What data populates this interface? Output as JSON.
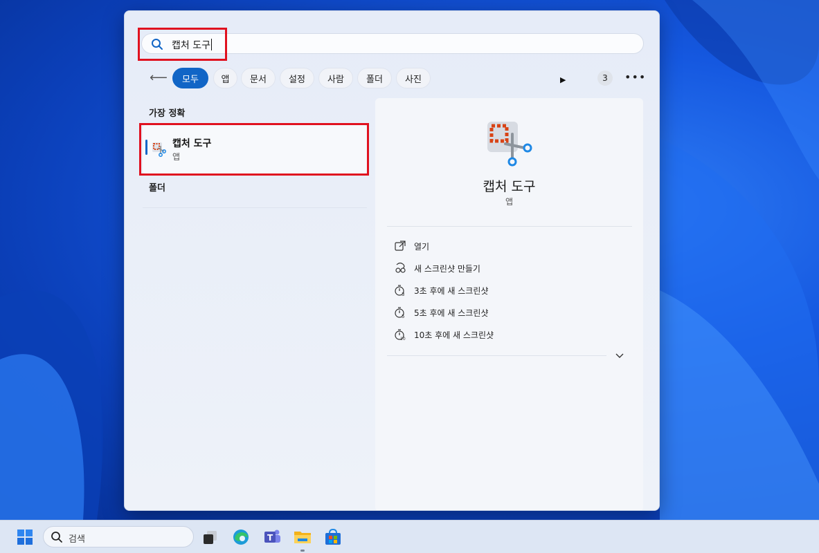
{
  "search": {
    "query": "캡처 도구"
  },
  "filters": {
    "chips": [
      "모두",
      "앱",
      "문서",
      "설정",
      "사람",
      "폴더",
      "사진"
    ],
    "active": "모두",
    "count": "3"
  },
  "results": {
    "best_match_heading": "가장 정확",
    "best_match": {
      "name": "캡처 도구",
      "type": "앱"
    },
    "folders_heading": "폴더"
  },
  "detail": {
    "title": "캡처 도구",
    "subtitle": "앱",
    "actions": [
      {
        "icon": "open-external-icon",
        "label": "열기"
      },
      {
        "icon": "new-snip-icon",
        "label": "새 스크린샷 만들기"
      },
      {
        "icon": "timer-3-icon",
        "label": "3초 후에 새 스크린샷"
      },
      {
        "icon": "timer-5-icon",
        "label": "5초 후에 새 스크린샷"
      },
      {
        "icon": "timer-10-icon",
        "label": "10초 후에 새 스크린샷"
      }
    ]
  },
  "taskbar": {
    "search_placeholder": "검색",
    "apps": [
      "task-view-icon",
      "edge-icon",
      "teams-icon",
      "file-explorer-icon",
      "microsoft-store-icon"
    ]
  },
  "colors": {
    "accent": "#1165c6",
    "highlight": "#e0111f"
  }
}
